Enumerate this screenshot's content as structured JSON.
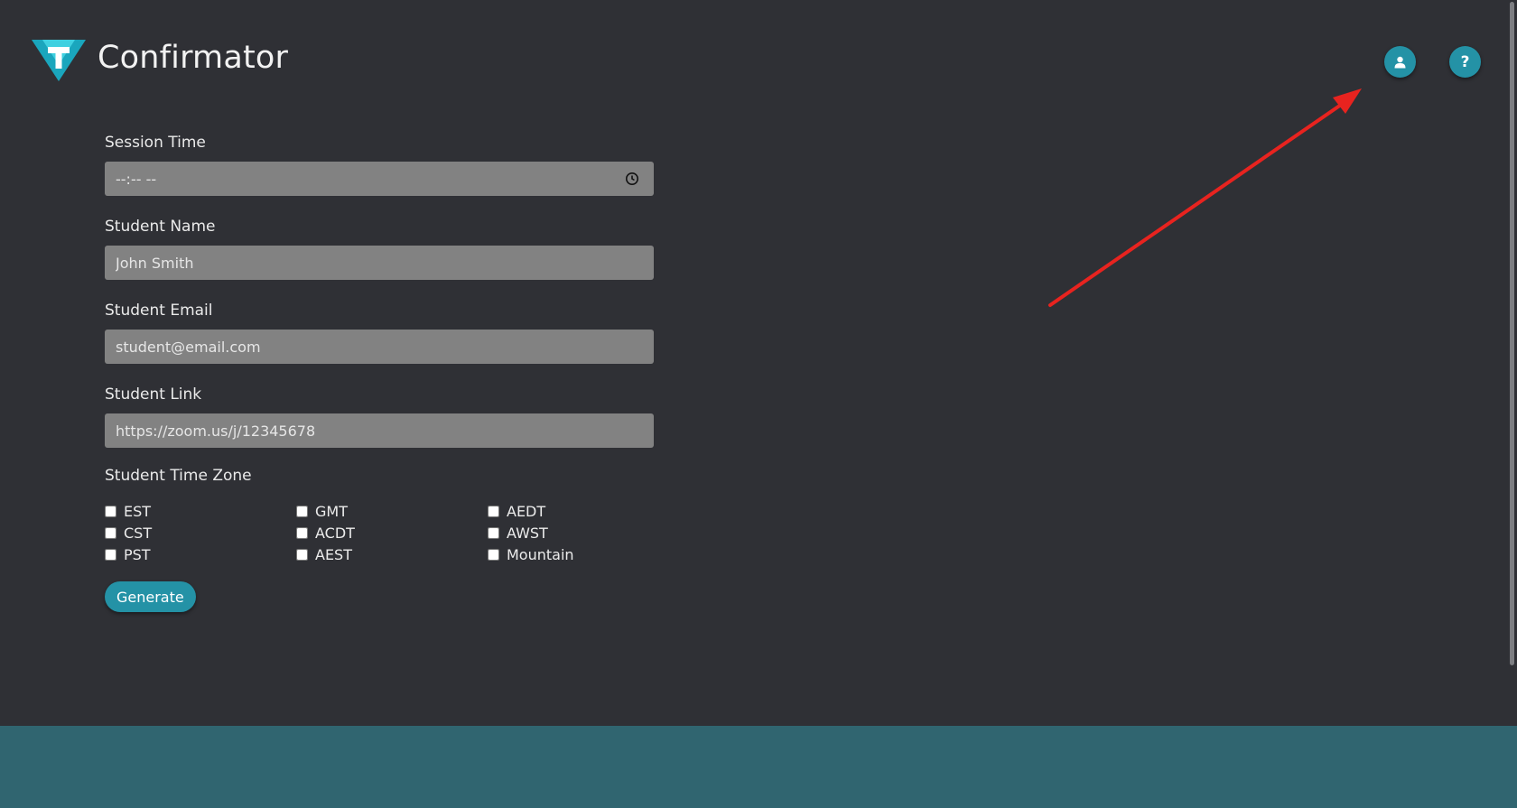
{
  "app": {
    "title": "Confirmator",
    "logo_icon": "shield-t-logo",
    "accent_color": "#2492a6"
  },
  "header": {
    "user_icon": "user-icon",
    "help_label": "?"
  },
  "form": {
    "session_time": {
      "label": "Session Time",
      "placeholder": "--:-- --"
    },
    "student_name": {
      "label": "Student Name",
      "placeholder": "John Smith"
    },
    "student_email": {
      "label": "Student Email",
      "placeholder": "student@email.com"
    },
    "student_link": {
      "label": "Student Link",
      "placeholder": "https://zoom.us/j/12345678"
    },
    "time_zone": {
      "label": "Student Time Zone",
      "options": [
        "EST",
        "GMT",
        "AEDT",
        "CST",
        "ACDT",
        "AWST",
        "PST",
        "AEST",
        "Mountain"
      ]
    },
    "generate_label": "Generate"
  },
  "annotation": {
    "arrow_color": "#e8231f"
  },
  "footer": {
    "color": "#306570"
  }
}
